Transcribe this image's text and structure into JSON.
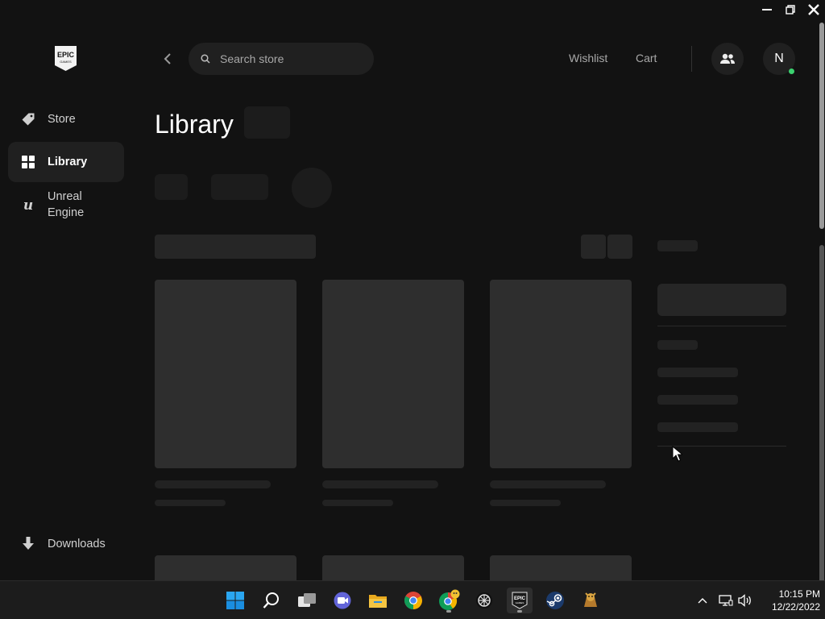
{
  "window": {
    "controls": [
      "minimize",
      "restore",
      "close"
    ]
  },
  "sidebar": {
    "logo_text": "EPIC GAMES",
    "items": [
      {
        "label": "Store",
        "icon": "tag-icon",
        "active": false
      },
      {
        "label": "Library",
        "icon": "grid-icon",
        "active": true
      },
      {
        "label": "Unreal Engine",
        "icon": "unreal-engine-icon",
        "active": false
      }
    ],
    "downloads": {
      "label": "Downloads",
      "icon": "download-icon"
    }
  },
  "topbar": {
    "search_placeholder": "Search store",
    "wishlist": "Wishlist",
    "cart": "Cart",
    "avatar_initial": "N",
    "online_color": "#3bd16f"
  },
  "main": {
    "title": "Library",
    "state": "loading-skeleton"
  },
  "taskbar": {
    "apps": [
      "windows-start-icon",
      "search-icon",
      "task-view-icon",
      "chat-icon",
      "file-explorer-icon",
      "chrome-icon",
      "chrome-profile-icon",
      "app-icon",
      "epic-games-icon",
      "steam-icon",
      "game-icon"
    ],
    "clock": {
      "time": "10:15 PM",
      "date": "12/22/2022"
    }
  }
}
